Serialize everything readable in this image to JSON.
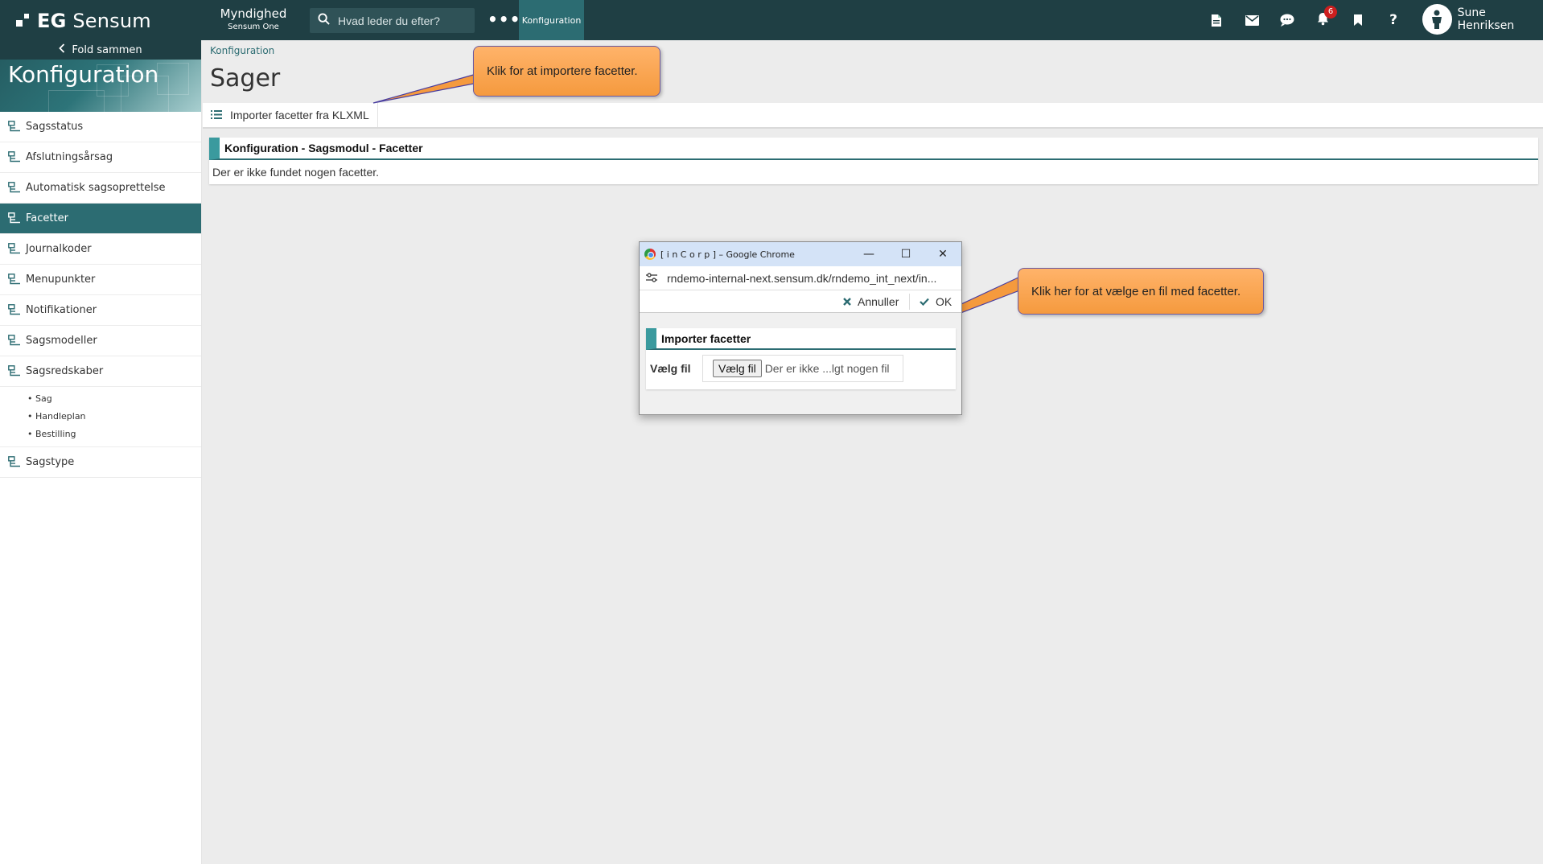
{
  "topbar": {
    "logo_prefix": "EG",
    "logo_name": "Sensum",
    "org_name": "Myndighed",
    "org_sub": "Sensum One",
    "search_placeholder": "Hvad leder du efter?",
    "more_label": "•••",
    "active_tab": "Konfiguration",
    "notification_count": "6",
    "user_name": "Sune Henriksen",
    "icons": [
      "document-icon",
      "mail-icon",
      "chat-icon",
      "bell-icon",
      "bookmark-icon",
      "help-icon"
    ]
  },
  "sidebar": {
    "collapse_label": "Fold sammen",
    "title": "Konfiguration",
    "items": [
      {
        "label": "Sagsstatus",
        "active": false
      },
      {
        "label": "Afslutningsårsag",
        "active": false
      },
      {
        "label": "Automatisk sagsoprettelse",
        "active": false
      },
      {
        "label": "Facetter",
        "active": true
      },
      {
        "label": "Journalkoder",
        "active": false
      },
      {
        "label": "Menupunkter",
        "active": false
      },
      {
        "label": "Notifikationer",
        "active": false
      },
      {
        "label": "Sagsmodeller",
        "active": false
      },
      {
        "label": "Sagsredskaber",
        "active": false
      },
      {
        "label": "Sagstype",
        "active": false
      }
    ],
    "sub_items": [
      "• Sag",
      "• Handleplan",
      "• Bestilling"
    ]
  },
  "main": {
    "breadcrumb": "Konfiguration",
    "title": "Sager",
    "import_button": "Importer facetter fra KLXML",
    "panel_title": "Konfiguration - Sagsmodul - Facetter",
    "panel_empty": "Der er ikke fundet nogen facetter."
  },
  "callouts": {
    "import_hint": "Klik for at importere facetter.",
    "file_hint": "Klik her for at vælge en fil med facetter."
  },
  "popup": {
    "window_title": "[ i n C o r p ] – Google Chrome",
    "url": "rndemo-internal-next.sensum.dk/rndemo_int_next/in...",
    "cancel_label": "Annuller",
    "ok_label": "OK",
    "panel_title": "Importer facetter",
    "file_label": "Vælg fil",
    "file_button": "Vælg fil",
    "file_status": "Der er ikke ...lgt nogen fil",
    "window_buttons": [
      "—",
      "☐",
      "✕"
    ]
  },
  "colors": {
    "topbar": "#1f3f44",
    "accent": "#2c6c72",
    "panel_stripe": "#3a9a9e",
    "callout": "#f59a3e",
    "badge": "#cc1f1f"
  }
}
